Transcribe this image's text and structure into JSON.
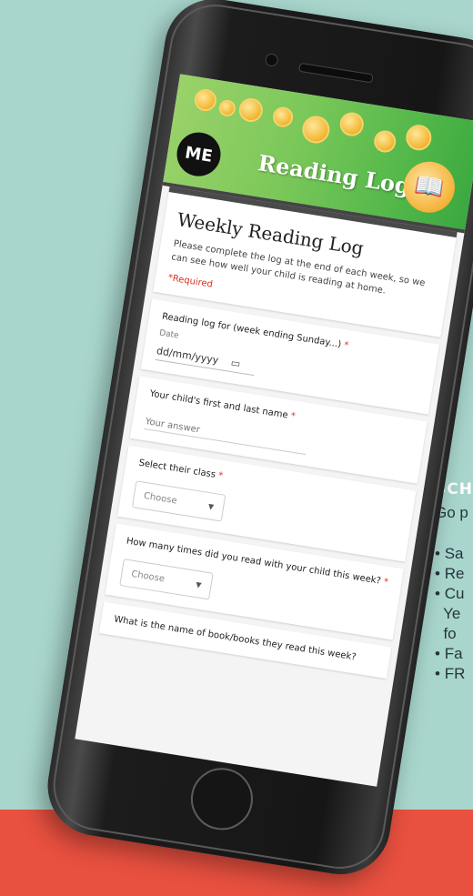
{
  "side": {
    "heading": "SCH",
    "intro": "Go p",
    "items": [
      "Sa",
      "Re",
      "Cu",
      "Ye",
      "fo",
      "Fa",
      "FR"
    ]
  },
  "banner": {
    "logo": "ME",
    "title": "Reading Log",
    "book_label": "Book"
  },
  "form": {
    "title": "Weekly Reading Log",
    "description": "Please complete the log at the end of each week, so we can see how well your child is reading at home.",
    "required_note": "*Required"
  },
  "questions": {
    "q1": {
      "label": "Reading log for (week ending Sunday...)",
      "req": "*",
      "sub_label": "Date",
      "value": "dd/mm/yyyy"
    },
    "q2": {
      "label": "Your child's first and last name",
      "req": "*",
      "placeholder": "Your answer"
    },
    "q3": {
      "label": "Select their class",
      "req": "*",
      "selected": "Choose"
    },
    "q4": {
      "label": "How many times did you read with your child this week?",
      "req": "*",
      "selected": "Choose"
    },
    "q5": {
      "label": "What is the name of book/books they read this week?"
    }
  },
  "icons": {
    "calendar": "calendar-icon",
    "dropdown": "chevron-down-icon"
  },
  "colors": {
    "background": "#a8d6cd",
    "footer": "#e8503f",
    "required": "#d93025",
    "banner_green": "#7cc85a"
  }
}
